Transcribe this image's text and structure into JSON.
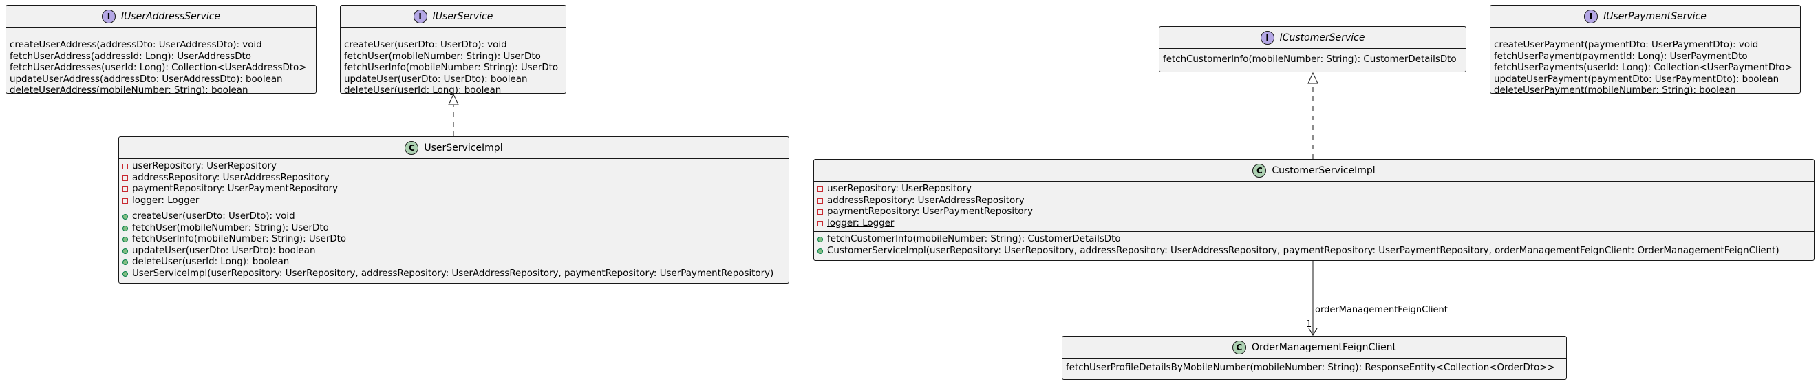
{
  "interfaces": {
    "i_user_address_service": {
      "badge": "I",
      "name": "IUserAddressService",
      "methods": [
        "createUserAddress(addressDto: UserAddressDto): void",
        "fetchUserAddress(addressId: Long): UserAddressDto",
        "fetchUserAddresses(userId: Long): Collection<UserAddressDto>",
        "updateUserAddress(addressDto: UserAddressDto): boolean",
        "deleteUserAddress(mobileNumber: String): boolean"
      ]
    },
    "i_user_service": {
      "badge": "I",
      "name": "IUserService",
      "methods": [
        "createUser(userDto: UserDto): void",
        "fetchUser(mobileNumber: String): UserDto",
        "fetchUserInfo(mobileNumber: String): UserDto",
        "updateUser(userDto: UserDto): boolean",
        "deleteUser(userId: Long): boolean"
      ]
    },
    "i_customer_service": {
      "badge": "I",
      "name": "ICustomerService",
      "methods": [
        "fetchCustomerInfo(mobileNumber: String): CustomerDetailsDto"
      ]
    },
    "i_user_payment_service": {
      "badge": "I",
      "name": "IUserPaymentService",
      "methods": [
        "createUserPayment(paymentDto: UserPaymentDto): void",
        "fetchUserPayment(paymentId: Long): UserPaymentDto",
        "fetchUserPayments(userId: Long): Collection<UserPaymentDto>",
        "updateUserPayment(paymentDto: UserPaymentDto): boolean",
        "deleteUserPayment(mobileNumber: String): boolean"
      ]
    }
  },
  "classes": {
    "user_service_impl": {
      "badge": "C",
      "name": "UserServiceImpl",
      "attributes": [
        "userRepository: UserRepository",
        "addressRepository: UserAddressRepository",
        "paymentRepository: UserPaymentRepository",
        "logger: Logger"
      ],
      "methods": [
        "createUser(userDto: UserDto): void",
        "fetchUser(mobileNumber: String): UserDto",
        "fetchUserInfo(mobileNumber: String): UserDto",
        "updateUser(userDto: UserDto): boolean",
        "deleteUser(userId: Long): boolean",
        "UserServiceImpl(userRepository: UserRepository, addressRepository: UserAddressRepository, paymentRepository: UserPaymentRepository)"
      ]
    },
    "customer_service_impl": {
      "badge": "C",
      "name": "CustomerServiceImpl",
      "attributes": [
        "userRepository: UserRepository",
        "addressRepository: UserAddressRepository",
        "paymentRepository: UserPaymentRepository",
        "logger: Logger"
      ],
      "methods": [
        "fetchCustomerInfo(mobileNumber: String): CustomerDetailsDto",
        "CustomerServiceImpl(userRepository: UserRepository, addressRepository: UserAddressRepository, paymentRepository: UserPaymentRepository, orderManagementFeignClient: OrderManagementFeignClient)"
      ]
    },
    "order_management_feign_client": {
      "badge": "C",
      "name": "OrderManagementFeignClient",
      "methods": [
        "fetchUserProfileDetailsByMobileNumber(mobileNumber: String): ResponseEntity<Collection<OrderDto>>"
      ]
    }
  },
  "relations": {
    "association_label": "orderManagementFeignClient",
    "multiplicity": "1"
  },
  "colors": {
    "box_fill": "#f1f1f1",
    "border": "#181818",
    "interface_badge": "#b4a7e5",
    "class_badge": "#add1b2"
  }
}
